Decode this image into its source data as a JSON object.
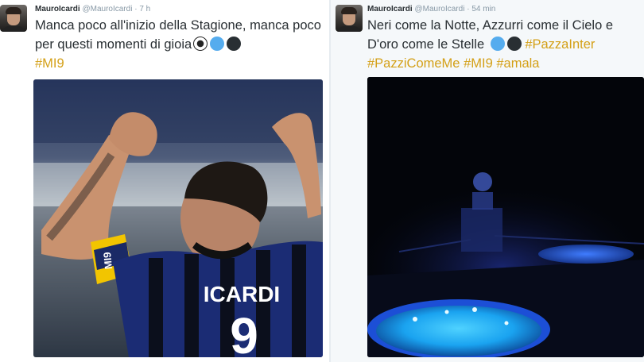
{
  "tweets": [
    {
      "user": {
        "name": "MauroIcardi",
        "handle": "@MauroIcardi"
      },
      "time": "7 h",
      "text": "Manca poco all'inizio della Stagione, manca poco per questi momenti di gioia",
      "hashtags": [
        "#MI9"
      ],
      "photo": {
        "jersey_name": "ICARDI",
        "jersey_number": "9",
        "armband": "MI9"
      }
    },
    {
      "user": {
        "name": "MauroIcardi",
        "handle": "@MauroIcardi"
      },
      "time": "54 min",
      "text_line1": "Neri come la Notte, Azzurri come il Cielo e",
      "text_line2": "D'oro come le Stelle",
      "hashtags": [
        "#PazzaInter",
        "#PazziComeMe",
        "#MI9",
        "#amala"
      ]
    }
  ],
  "separator": "·",
  "colors": {
    "hashtag": "#d4a017",
    "blue_heart": "#55acee",
    "black_heart": "#292f33"
  },
  "icons": [
    "soccer-ball-icon",
    "blue-circle-icon",
    "black-circle-icon"
  ]
}
